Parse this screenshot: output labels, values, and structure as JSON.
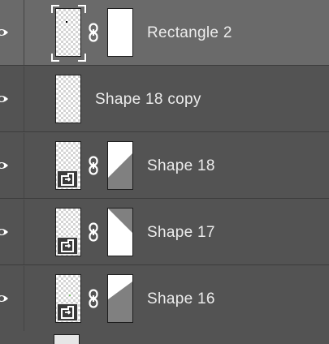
{
  "layers_panel": {
    "layers": [
      {
        "name": "Rectangle 2",
        "selected": true,
        "type": "shape-with-mask"
      },
      {
        "name": "Shape 18 copy",
        "selected": false,
        "type": "plain"
      },
      {
        "name": "Shape 18",
        "selected": false,
        "type": "smart-object-with-mask",
        "mask_pattern": "diagonal-lower-right"
      },
      {
        "name": "Shape 17",
        "selected": false,
        "type": "smart-object-with-mask",
        "mask_pattern": "diagonal-lower-left"
      },
      {
        "name": "Shape 16",
        "selected": false,
        "type": "smart-object-with-mask",
        "mask_pattern": "diagonal-lower-large"
      }
    ],
    "colors": {
      "panel_bg": "#535353",
      "selected_row_bg": "#6a6a6a",
      "text": "#ececec",
      "mask_white": "#ffffff",
      "mask_gray": "#808080"
    },
    "icons": [
      "eye-icon",
      "chain-link-icon",
      "smart-object-icon"
    ]
  }
}
